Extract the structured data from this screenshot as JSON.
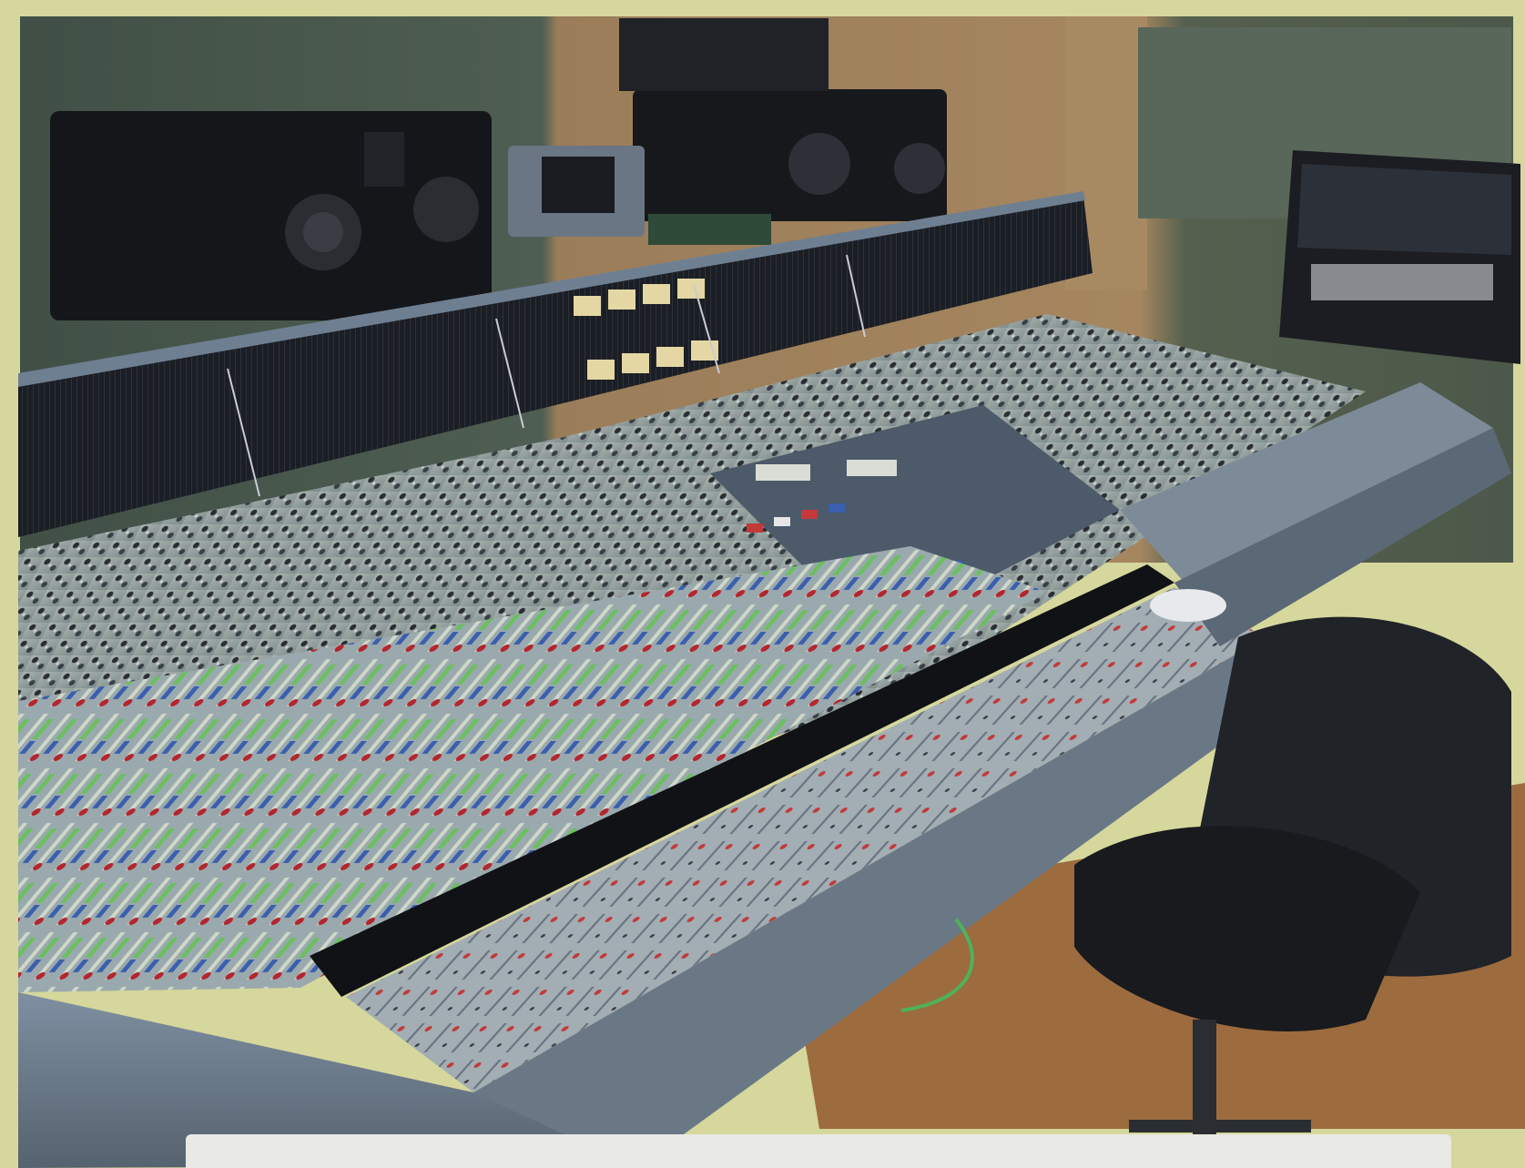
{
  "photo": {
    "subject": "studio-mixing-console",
    "colors": {
      "border": "#d6d79c",
      "wall_green": "#4e5d50",
      "wall_wood": "#9a7a58",
      "speaker": "#15161a",
      "console_body": "#6f7f92",
      "meter_bridge": "#1d2027",
      "channel_strip": "#9aa7a6",
      "knob_red": "#b3262f",
      "fader_green": "#6cbf60",
      "fader_blue": "#3b5fae",
      "floor": "#9c6b3e",
      "chair": "#202328",
      "caption_strip": "#e9eae6"
    }
  }
}
